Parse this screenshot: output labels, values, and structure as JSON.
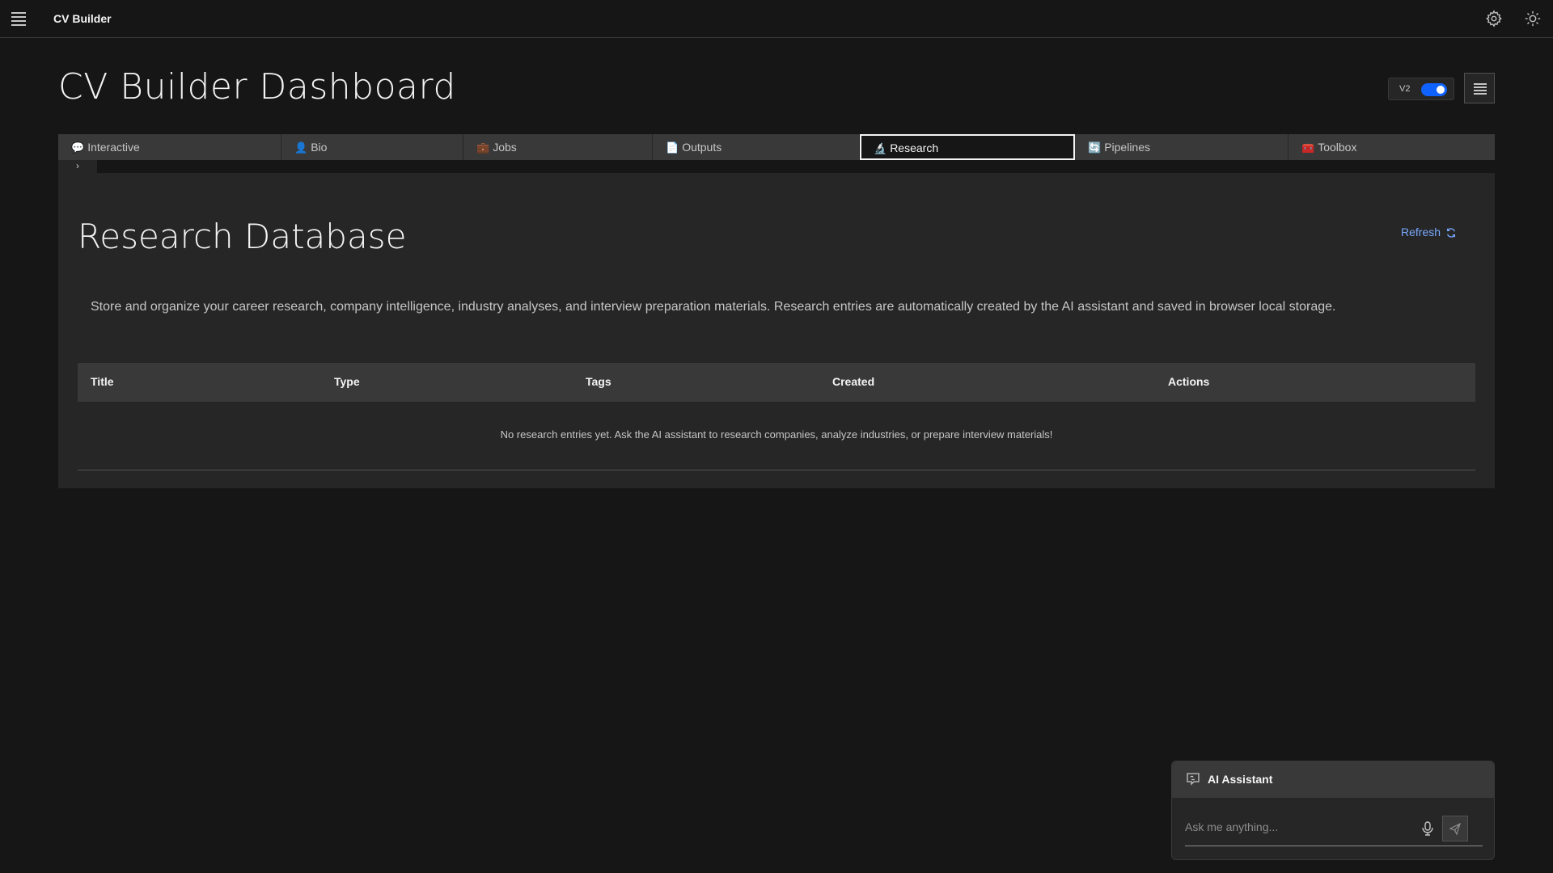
{
  "app": {
    "title": "CV Builder"
  },
  "header": {
    "page_title": "CV Builder Dashboard",
    "version_label": "V2",
    "version_enabled": true
  },
  "tabs": [
    {
      "icon": "💬",
      "label": "Interactive",
      "active": false
    },
    {
      "icon": "👤",
      "label": "Bio",
      "active": false
    },
    {
      "icon": "💼",
      "label": "Jobs",
      "active": false
    },
    {
      "icon": "📄",
      "label": "Outputs",
      "active": false
    },
    {
      "icon": "🔬",
      "label": "Research",
      "active": true
    },
    {
      "icon": "🔄",
      "label": "Pipelines",
      "active": false
    },
    {
      "icon": "🧰",
      "label": "Toolbox",
      "active": false
    }
  ],
  "research": {
    "title": "Research Database",
    "refresh_label": "Refresh",
    "description": "Store and organize your career research, company intelligence, industry analyses, and interview preparation materials. Research entries are automatically created by the AI assistant and saved in browser local storage.",
    "columns": [
      "Title",
      "Type",
      "Tags",
      "Created",
      "Actions"
    ],
    "empty_message": "No research entries yet. Ask the AI assistant to research companies, analyze industries, or prepare interview materials!"
  },
  "assistant": {
    "title": "AI Assistant",
    "placeholder": "Ask me anything..."
  },
  "colors": {
    "accent": "#0f62fe",
    "link": "#78a9ff",
    "background": "#161616",
    "panel": "#262626"
  }
}
